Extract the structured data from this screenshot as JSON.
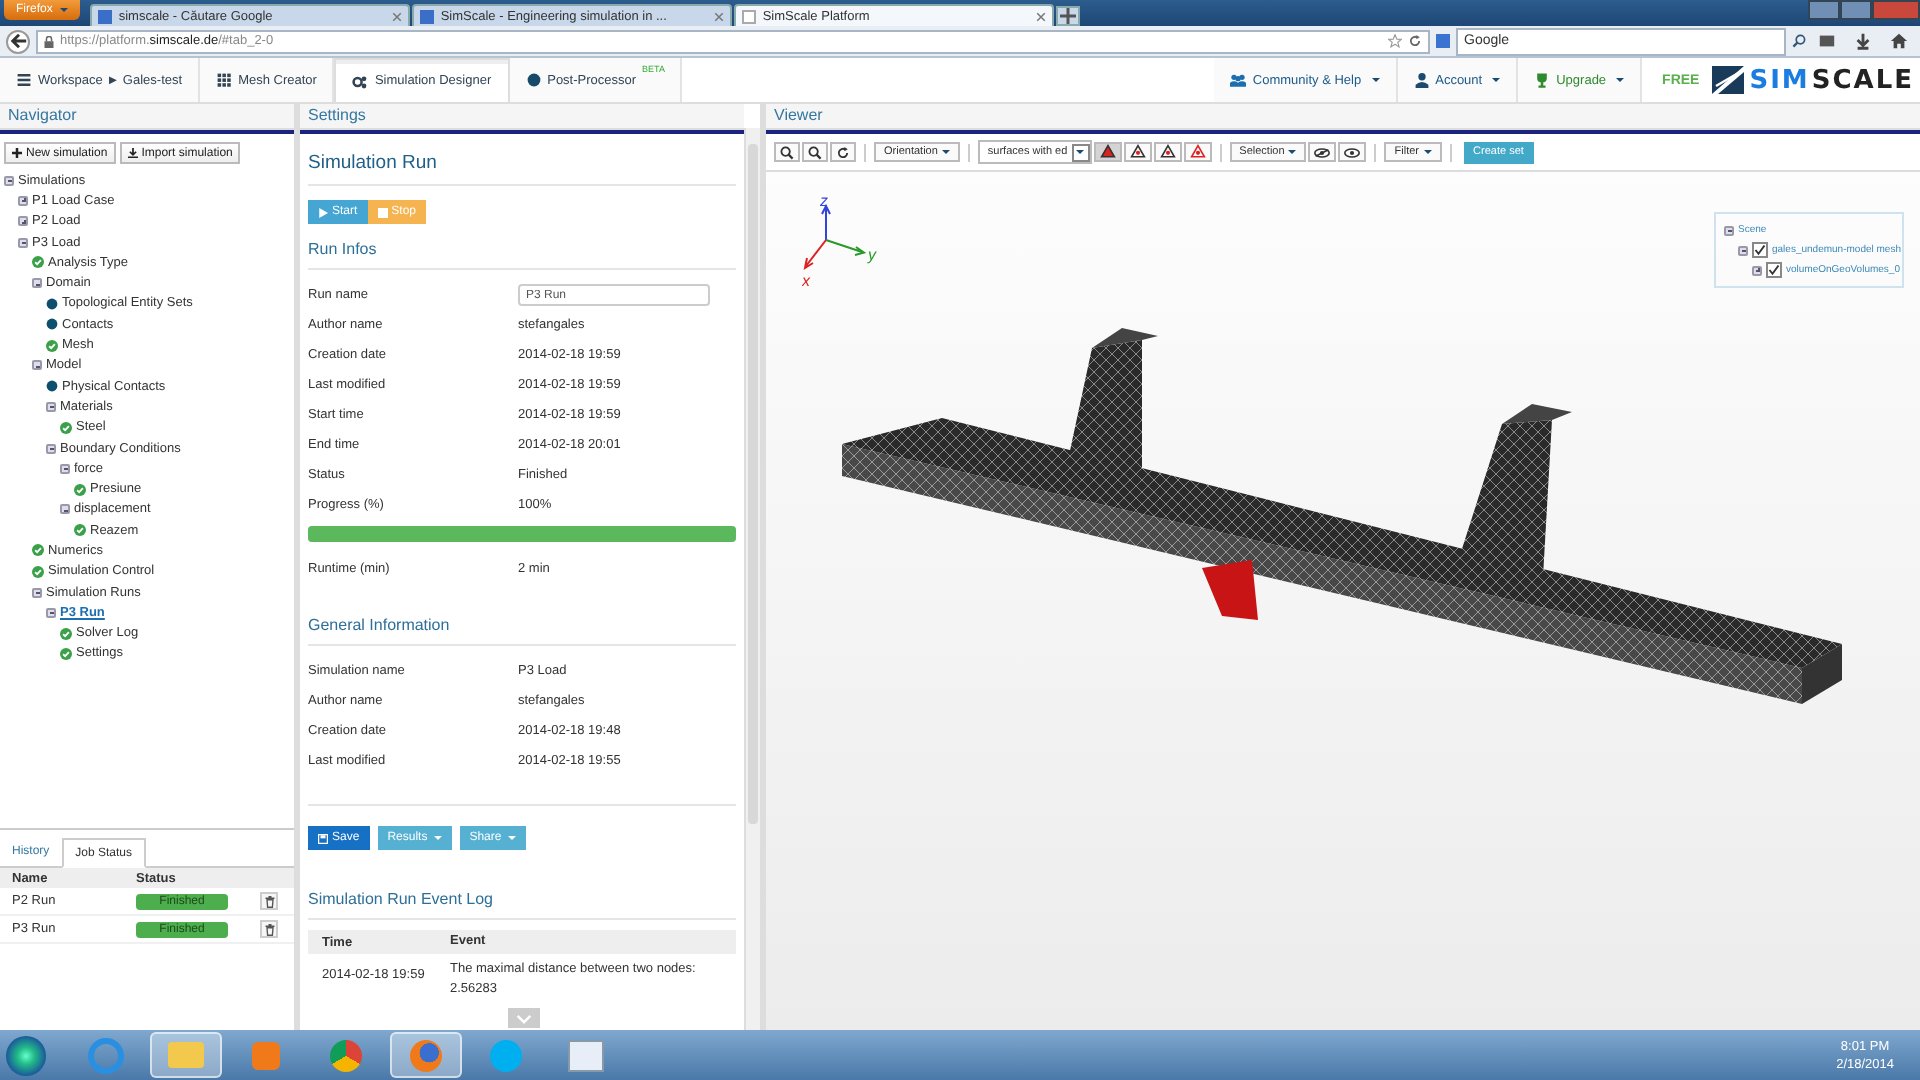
{
  "browser": {
    "menu_button": "Firefox",
    "tabs": [
      {
        "title": "simscale - Căutare Google",
        "selected": false
      },
      {
        "title": "SimScale - Engineering simulation in ...",
        "selected": false
      },
      {
        "title": "SimScale Platform",
        "selected": true
      }
    ],
    "url_prefix": "https://platform.",
    "url_domain": "simscale.de",
    "url_rest": "/#tab_2-0",
    "search_placeholder": "Google"
  },
  "app_nav": {
    "items": [
      {
        "label": "Workspace ► Gales-test",
        "selected": false,
        "kind": "workspace"
      },
      {
        "label": "Mesh Creator",
        "selected": false,
        "kind": "grid"
      },
      {
        "label": "Simulation Designer",
        "selected": true,
        "kind": "gears"
      },
      {
        "label": "Post-Processor",
        "selected": false,
        "kind": "dot",
        "badge": "BETA"
      }
    ],
    "right_items": [
      {
        "label": "Community & Help",
        "kind": "people"
      },
      {
        "label": "Account",
        "kind": "person"
      },
      {
        "label": "Upgrade",
        "kind": "trophy"
      }
    ],
    "plan": "FREE",
    "logo_first": "SIM",
    "logo_second": "SCALE"
  },
  "navigator": {
    "title": "Navigator",
    "buttons": [
      {
        "label": "New simulation",
        "kind": "plus"
      },
      {
        "label": "Import simulation",
        "kind": "import"
      }
    ],
    "tree": [
      {
        "label": "Simulations",
        "kind": "folder",
        "expanded": true,
        "selected": false,
        "children": [
          {
            "label": "P1 Load Case",
            "kind": "folder",
            "expanded": false,
            "selected": false
          },
          {
            "label": "P2 Load",
            "kind": "folder",
            "expanded": false,
            "selected": false
          },
          {
            "label": "P3 Load",
            "kind": "folder",
            "expanded": true,
            "selected": false,
            "children": [
              {
                "label": "Analysis Type",
                "kind": "ok",
                "selected": false
              },
              {
                "label": "Domain",
                "kind": "folder",
                "expanded": true,
                "selected": false,
                "children": [
                  {
                    "label": "Topological Entity Sets",
                    "kind": "dot",
                    "selected": false
                  },
                  {
                    "label": "Contacts",
                    "kind": "dot",
                    "selected": false
                  },
                  {
                    "label": "Mesh",
                    "kind": "ok",
                    "selected": false
                  }
                ]
              },
              {
                "label": "Model",
                "kind": "folder",
                "expanded": true,
                "selected": false,
                "children": [
                  {
                    "label": "Physical Contacts",
                    "kind": "dot",
                    "selected": false
                  },
                  {
                    "label": "Materials",
                    "kind": "folder",
                    "expanded": true,
                    "selected": false,
                    "children": [
                      {
                        "label": "Steel",
                        "kind": "ok",
                        "selected": false
                      }
                    ]
                  },
                  {
                    "label": "Boundary Conditions",
                    "kind": "folder",
                    "expanded": true,
                    "selected": false,
                    "children": [
                      {
                        "label": "force",
                        "kind": "folder",
                        "expanded": true,
                        "selected": false,
                        "children": [
                          {
                            "label": "Presiune",
                            "kind": "ok",
                            "selected": false
                          }
                        ]
                      },
                      {
                        "label": "displacement",
                        "kind": "folder",
                        "expanded": true,
                        "selected": false,
                        "children": [
                          {
                            "label": "Reazem",
                            "kind": "ok",
                            "selected": false
                          }
                        ]
                      }
                    ]
                  }
                ]
              },
              {
                "label": "Numerics",
                "kind": "ok",
                "selected": false
              },
              {
                "label": "Simulation Control",
                "kind": "ok",
                "selected": false
              },
              {
                "label": "Simulation Runs",
                "kind": "folder",
                "expanded": true,
                "selected": false,
                "children": [
                  {
                    "label": "P3 Run",
                    "kind": "folder",
                    "expanded": true,
                    "selected": true,
                    "children": [
                      {
                        "label": "Solver Log",
                        "kind": "ok",
                        "selected": false
                      },
                      {
                        "label": "Settings",
                        "kind": "ok",
                        "selected": false
                      }
                    ]
                  }
                ]
              }
            ]
          }
        ]
      }
    ]
  },
  "job_panel": {
    "tabs": [
      {
        "label": "History",
        "selected": false
      },
      {
        "label": "Job Status",
        "selected": true
      }
    ],
    "columns": [
      "Name",
      "Status"
    ],
    "rows": [
      {
        "name": "P2 Run",
        "status": "Finished"
      },
      {
        "name": "P3 Run",
        "status": "Finished"
      }
    ]
  },
  "settings": {
    "title": "Settings",
    "heading": "Simulation Run",
    "run_buttons": [
      {
        "label": "Start",
        "kind": "start"
      },
      {
        "label": "Stop",
        "kind": "stop"
      }
    ],
    "run_infos_heading": "Run Infos",
    "run_infos": [
      {
        "label": "Run name",
        "value": "P3 Run",
        "kind": "input"
      },
      {
        "label": "Author name",
        "value": "stefangales",
        "kind": "text"
      },
      {
        "label": "Creation date",
        "value": "2014-02-18 19:59",
        "kind": "text"
      },
      {
        "label": "Last modified",
        "value": "2014-02-18 19:59",
        "kind": "text"
      },
      {
        "label": "Start time",
        "value": "2014-02-18 19:59",
        "kind": "text"
      },
      {
        "label": "End time",
        "value": "2014-02-18 20:01",
        "kind": "text"
      },
      {
        "label": "Status",
        "value": "Finished",
        "kind": "text"
      },
      {
        "label": "Progress (%)",
        "value": "100%",
        "kind": "text"
      }
    ],
    "progress": {
      "level": 1.0
    },
    "runtime": {
      "label": "Runtime (min)",
      "value": "2 min"
    },
    "general_heading": "General Information",
    "general": [
      {
        "label": "Simulation name",
        "value": "P3 Load"
      },
      {
        "label": "Author name",
        "value": "stefangales"
      },
      {
        "label": "Creation date",
        "value": "2014-02-18 19:48"
      },
      {
        "label": "Last modified",
        "value": "2014-02-18 19:55"
      }
    ],
    "actions": [
      {
        "label": "Save",
        "kind": "save"
      },
      {
        "label": "Results",
        "kind": "menu"
      },
      {
        "label": "Share",
        "kind": "menu"
      }
    ],
    "log_heading": "Simulation Run Event Log",
    "log_columns": [
      "Time",
      "Event"
    ],
    "log_rows": [
      {
        "time": "2014-02-18 19:59",
        "event": "The maximal distance between two nodes: 2.56283"
      }
    ]
  },
  "viewer": {
    "title": "Viewer",
    "orientation": "Orientation",
    "render_select": "surfaces with ed",
    "render_modes": [
      {
        "selected": true
      },
      {
        "selected": false
      },
      {
        "selected": false
      },
      {
        "selected": false
      }
    ],
    "selection": "Selection",
    "filter": "Filter",
    "create_set": "Create set",
    "axes": {
      "z": "z",
      "y": "y",
      "x": "x"
    },
    "scene": [
      {
        "label": "Scene",
        "expanded": true,
        "children": [
          {
            "label": "gales_undemun-model mesh",
            "checked": true,
            "expanded": true,
            "children": [
              {
                "label": "volumeOnGeoVolumes_0",
                "checked": true,
                "expanded": false
              }
            ]
          }
        ]
      }
    ]
  },
  "taskbar": {
    "time": "8:01 PM",
    "date": "2/18/2014"
  }
}
